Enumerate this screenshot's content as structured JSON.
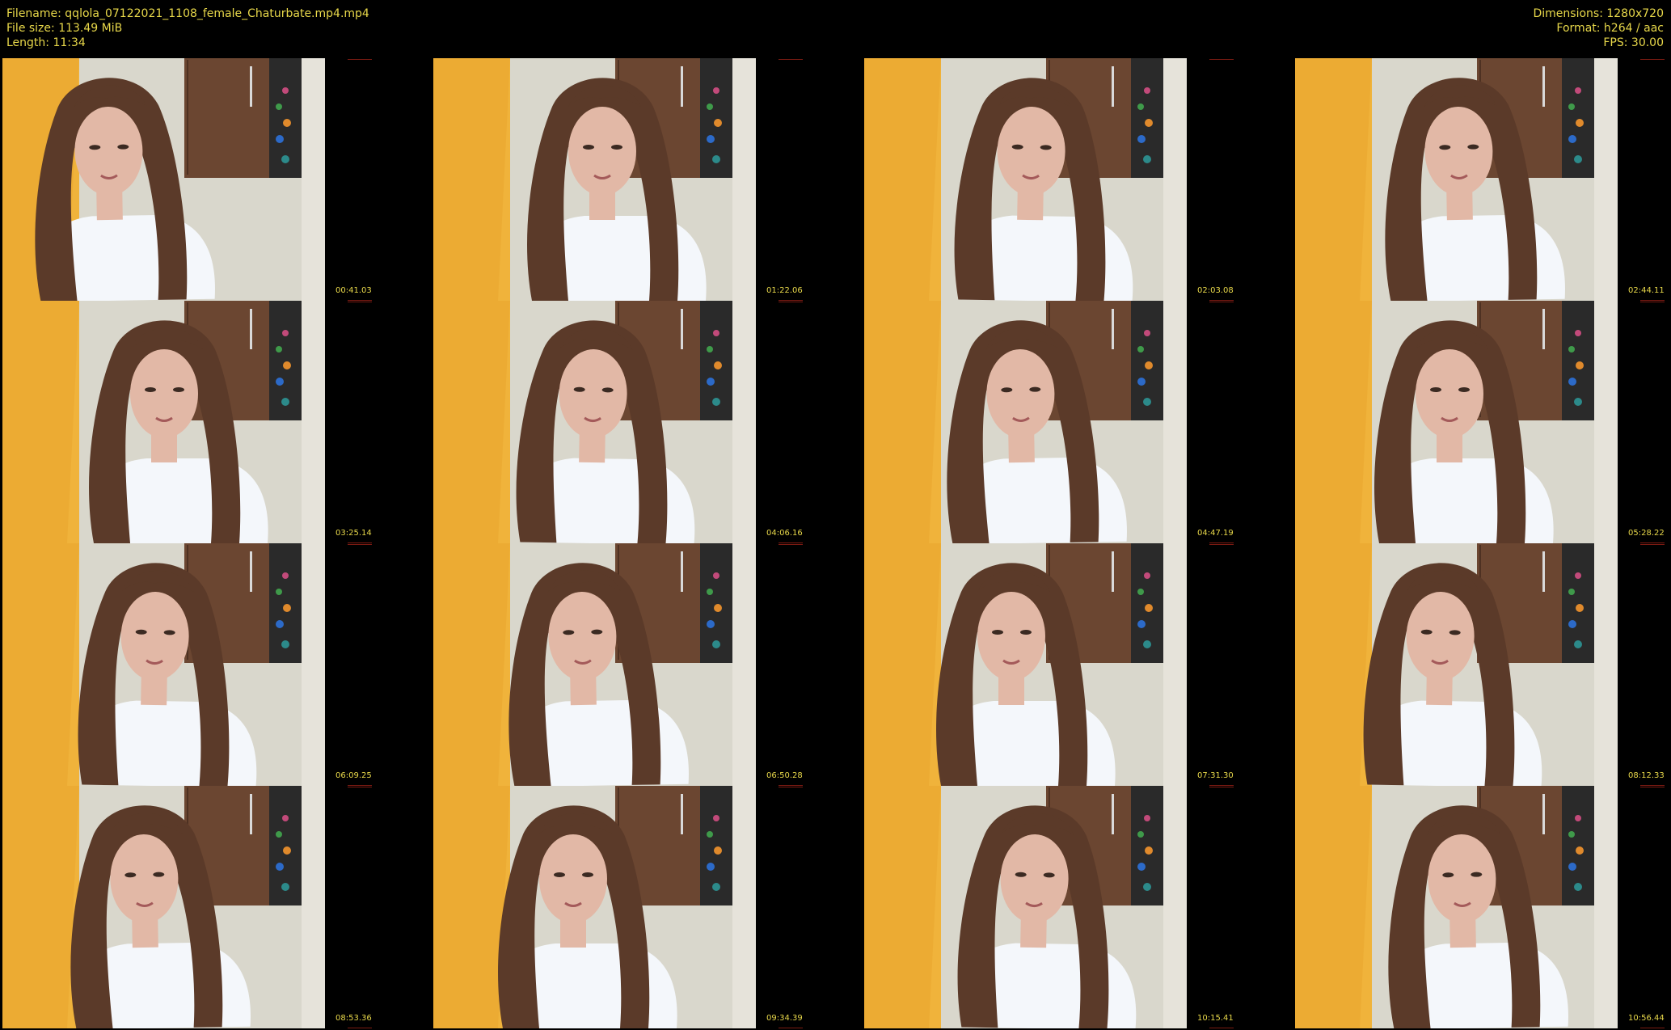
{
  "header": {
    "filename": "Filename: qqlola_07122021_1108_female_Chaturbate.mp4.mp4",
    "filesize": "File size: 113.49 MiB",
    "length": "Length: 11:34",
    "dimensions": "Dimensions: 1280x720",
    "format": "Format: h264 / aac",
    "fps": "FPS: 30.00"
  },
  "thumbnails": [
    {
      "time": "00:41.03"
    },
    {
      "time": "01:22.06"
    },
    {
      "time": "02:03.08"
    },
    {
      "time": "02:44.11"
    },
    {
      "time": "03:25.14"
    },
    {
      "time": "04:06.16"
    },
    {
      "time": "04:47.19"
    },
    {
      "time": "05:28.22"
    },
    {
      "time": "06:09.25"
    },
    {
      "time": "06:50.28"
    },
    {
      "time": "07:31.30"
    },
    {
      "time": "08:12.33"
    },
    {
      "time": "08:53.36"
    },
    {
      "time": "09:34.39"
    },
    {
      "time": "10:15.41"
    },
    {
      "time": "10:56.44"
    }
  ],
  "colors": {
    "text": "#e8d84a",
    "background": "#000000",
    "curtain": "#f0b33b",
    "wall": "#d9d7cc",
    "cabinet": "#6b4631",
    "shirt": "#f4f7fb",
    "hair": "#5b3a29",
    "skin": "#e2b8a6"
  }
}
